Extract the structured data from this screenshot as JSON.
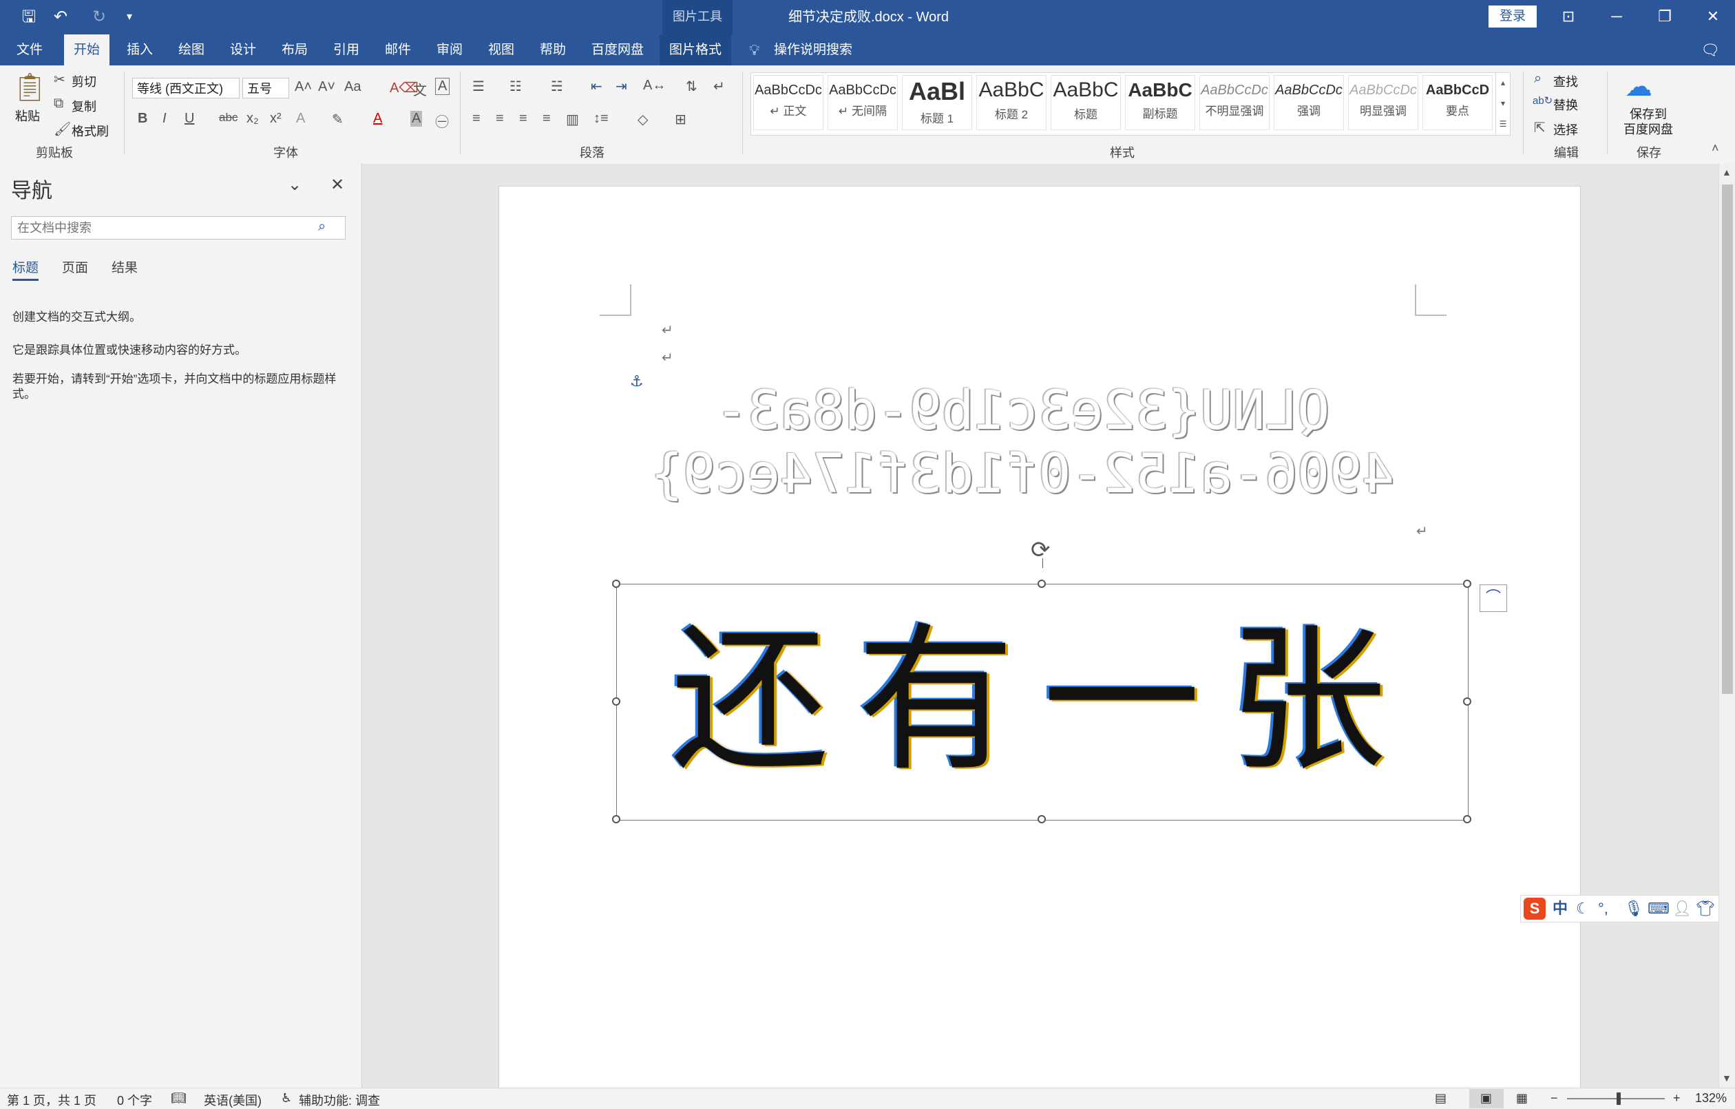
{
  "titlebar": {
    "doc_title": "细节决定成败.docx - Word",
    "context_tab_group": "图片工具",
    "login": "登录"
  },
  "tabs": [
    "文件",
    "开始",
    "插入",
    "绘图",
    "设计",
    "布局",
    "引用",
    "邮件",
    "审阅",
    "视图",
    "帮助",
    "百度网盘",
    "图片格式"
  ],
  "tell_me": "操作说明搜索",
  "ribbon": {
    "clipboard": {
      "paste": "粘贴",
      "cut": "剪切",
      "copy": "复制",
      "format_painter": "格式刷",
      "label": "剪贴板"
    },
    "font": {
      "font_name": "等线 (西文正文)",
      "font_size": "五号",
      "label": "字体"
    },
    "paragraph": {
      "label": "段落"
    },
    "styles": {
      "label": "样式",
      "items": [
        {
          "sample": "AaBbCcDc",
          "name": "↵ 正文"
        },
        {
          "sample": "AaBbCcDc",
          "name": "↵ 无间隔"
        },
        {
          "sample": "AaBl",
          "name": "标题 1"
        },
        {
          "sample": "AaBbC",
          "name": "标题 2"
        },
        {
          "sample": "AaBbC",
          "name": "标题"
        },
        {
          "sample": "AaBbC",
          "name": "副标题"
        },
        {
          "sample": "AaBbCcDc",
          "name": "不明显强调"
        },
        {
          "sample": "AaBbCcDc",
          "name": "强调"
        },
        {
          "sample": "AaBbCcDc",
          "name": "明显强调"
        },
        {
          "sample": "AaBbCcD",
          "name": "要点"
        }
      ]
    },
    "editing": {
      "find": "查找",
      "replace": "替换",
      "select": "选择",
      "label": "编辑"
    },
    "save": {
      "line1": "保存到",
      "line2": "百度网盘",
      "label": "保存"
    }
  },
  "nav": {
    "title": "导航",
    "search_placeholder": "在文档中搜索",
    "tabs": [
      "标题",
      "页面",
      "结果"
    ],
    "lines": [
      "创建文档的交互式大纲。",
      "它是跟踪具体位置或快速移动内容的好方式。",
      "若要开始，请转到“开始”选项卡，并向文档中的标题应用标题样式。"
    ]
  },
  "document": {
    "mirrored_line1": "QLNU{32e3c1b9-d8a3-",
    "mirrored_line2": "4906-a152-0f1d3f174ec9}",
    "image_text": "还有一张"
  },
  "ime": {
    "label": "中"
  },
  "status": {
    "page": "第 1 页，共 1 页",
    "words": "0 个字",
    "language": "英语(美国)",
    "accessibility": "辅助功能: 调查",
    "zoom": "132%"
  }
}
